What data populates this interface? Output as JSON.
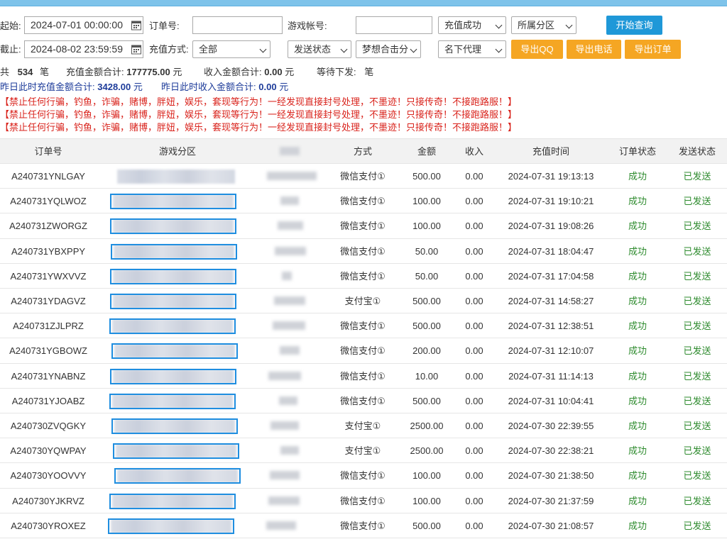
{
  "filters": {
    "start_label": "起始:",
    "start_value": "2024-07-01 00:00:00",
    "end_label": "截止:",
    "end_value": "2024-08-02 23:59:59",
    "order_label": "订单号:",
    "order_value": "",
    "account_label": "游戏帐号:",
    "account_value": "",
    "recharge_status": "充值成功",
    "zone": "所属分区",
    "method_label": "充值方式:",
    "method_value": "全部",
    "send_status": "发送状态",
    "server_name": "梦想合击分",
    "agent": "名下代理",
    "query_button": "开始查询",
    "export_qq": "导出QQ",
    "export_phone": "导出电话",
    "export_order": "导出订单"
  },
  "summary": {
    "total_prefix": "共",
    "total_count": "534",
    "total_suffix": "笔",
    "recharge_label": "充值金额合计:",
    "recharge_total": "177775.00",
    "recharge_unit": "元",
    "income_label": "收入金额合计:",
    "income_total": "0.00",
    "income_unit": "元",
    "pending_label": "等待下发:",
    "pending_unit": "笔",
    "yesterday_recharge_label": "昨日此时充值金额合计:",
    "yesterday_recharge_total": "3428.00",
    "yesterday_recharge_unit": "元",
    "yesterday_income_label": "昨日此时收入金额合计:",
    "yesterday_income_total": "0.00",
    "yesterday_income_unit": "元"
  },
  "warnings": [
    "【禁止任何行骗，钓鱼，诈骗，赌博，胖妞，娱乐，套现等行为！一经发现直接封号处理，不墨迹！只接传奇！不接跑路服！】",
    "【禁止任何行骗，钓鱼，诈骗，赌博，胖妞，娱乐，套现等行为！一经发现直接封号处理，不墨迹！只接传奇！不接跑路服！】",
    "【禁止任何行骗，钓鱼，诈骗，赌博，胖妞，娱乐，套现等行为！一经发现直接封号处理，不墨迹！只接传奇！不接跑路服！】"
  ],
  "table": {
    "headers": [
      "订单号",
      "游戏分区",
      "",
      "方式",
      "金额",
      "收入",
      "充值时间",
      "订单状态",
      "发送状态"
    ],
    "rows": [
      {
        "order": "A240731YNLGAY",
        "method": "微信支付①",
        "amount": "500.00",
        "income": "0.00",
        "time": "2024-07-31 19:13:13",
        "status": "成功",
        "send": "已发送"
      },
      {
        "order": "A240731YQLWOZ",
        "method": "微信支付①",
        "amount": "100.00",
        "income": "0.00",
        "time": "2024-07-31 19:10:21",
        "status": "成功",
        "send": "已发送"
      },
      {
        "order": "A240731ZWORGZ",
        "method": "微信支付①",
        "amount": "100.00",
        "income": "0.00",
        "time": "2024-07-31 19:08:26",
        "status": "成功",
        "send": "已发送"
      },
      {
        "order": "A240731YBXPPY",
        "method": "微信支付①",
        "amount": "50.00",
        "income": "0.00",
        "time": "2024-07-31 18:04:47",
        "status": "成功",
        "send": "已发送"
      },
      {
        "order": "A240731YWXVVZ",
        "method": "微信支付①",
        "amount": "50.00",
        "income": "0.00",
        "time": "2024-07-31 17:04:58",
        "status": "成功",
        "send": "已发送"
      },
      {
        "order": "A240731YDAGVZ",
        "method": "支付宝①",
        "amount": "500.00",
        "income": "0.00",
        "time": "2024-07-31 14:58:27",
        "status": "成功",
        "send": "已发送"
      },
      {
        "order": "A240731ZJLPRZ",
        "method": "微信支付①",
        "amount": "500.00",
        "income": "0.00",
        "time": "2024-07-31 12:38:51",
        "status": "成功",
        "send": "已发送"
      },
      {
        "order": "A240731YGBOWZ",
        "method": "微信支付①",
        "amount": "200.00",
        "income": "0.00",
        "time": "2024-07-31 12:10:07",
        "status": "成功",
        "send": "已发送"
      },
      {
        "order": "A240731YNABNZ",
        "method": "微信支付①",
        "amount": "10.00",
        "income": "0.00",
        "time": "2024-07-31 11:14:13",
        "status": "成功",
        "send": "已发送"
      },
      {
        "order": "A240731YJOABZ",
        "method": "微信支付①",
        "amount": "500.00",
        "income": "0.00",
        "time": "2024-07-31 10:04:41",
        "status": "成功",
        "send": "已发送"
      },
      {
        "order": "A240730ZVQGKY",
        "method": "支付宝①",
        "amount": "2500.00",
        "income": "0.00",
        "time": "2024-07-30 22:39:55",
        "status": "成功",
        "send": "已发送"
      },
      {
        "order": "A240730YQWPAY",
        "method": "支付宝①",
        "amount": "2500.00",
        "income": "0.00",
        "time": "2024-07-30 22:38:21",
        "status": "成功",
        "send": "已发送"
      },
      {
        "order": "A240730YOOVVY",
        "method": "微信支付①",
        "amount": "100.00",
        "income": "0.00",
        "time": "2024-07-30 21:38:50",
        "status": "成功",
        "send": "已发送"
      },
      {
        "order": "A240730YJKRVZ",
        "method": "微信支付①",
        "amount": "100.00",
        "income": "0.00",
        "time": "2024-07-30 21:37:59",
        "status": "成功",
        "send": "已发送"
      },
      {
        "order": "A240730YROXEZ",
        "method": "微信支付①",
        "amount": "500.00",
        "income": "0.00",
        "time": "2024-07-30 21:08:57",
        "status": "成功",
        "send": "已发送"
      }
    ]
  },
  "colors": {
    "accent_blue": "#1f98d8",
    "export_orange": "#f5a623",
    "warning_red": "#d9231c",
    "success_green": "#2e8b2e",
    "highlight_box": "#1f8ee0"
  }
}
